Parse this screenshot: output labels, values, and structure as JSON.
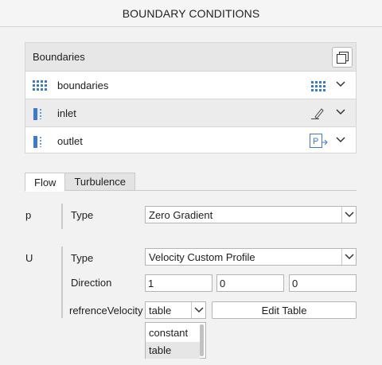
{
  "header": {
    "title": "BOUNDARY CONDITIONS"
  },
  "boundaries_panel": {
    "title": "Boundaries",
    "copy_icon": "copy-icon",
    "items": [
      {
        "label": "boundaries",
        "left_icon": "boundary-group-icon",
        "right_icon": "boundary-group-icon"
      },
      {
        "label": "inlet",
        "left_icon": "patch-icon",
        "right_icon": "pencil-icon"
      },
      {
        "label": "outlet",
        "left_icon": "patch-icon",
        "right_icon": "pressure-outlet-icon",
        "right_icon_text": "P"
      }
    ]
  },
  "tabs": [
    {
      "label": "Flow",
      "active": true
    },
    {
      "label": "Turbulence",
      "active": false
    }
  ],
  "flow": {
    "p": {
      "letter": "p",
      "type_label": "Type",
      "type_value": "Zero Gradient"
    },
    "U": {
      "letter": "U",
      "type_label": "Type",
      "type_value": "Velocity Custom Profile",
      "direction_label": "Direction",
      "direction": [
        "1",
        "0",
        "0"
      ],
      "ref_velocity_label": "refrenceVelocity",
      "ref_velocity_value": "table",
      "edit_table_label": "Edit Table",
      "ref_velocity_options": [
        "constant",
        "table"
      ]
    }
  },
  "colors": {
    "accent": "#3a7ad5",
    "panel_header": "#e7e7e7",
    "border": "#d6d6d6"
  }
}
